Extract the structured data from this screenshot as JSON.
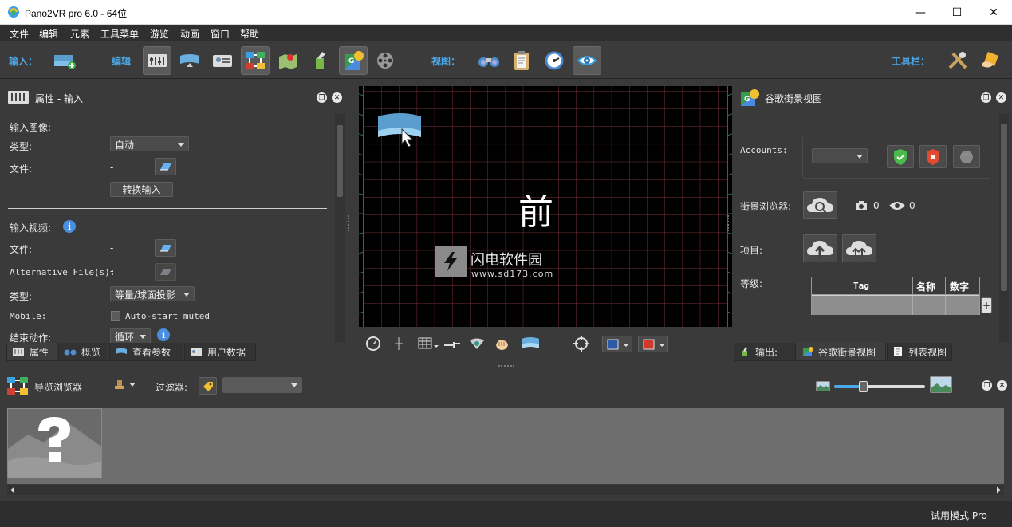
{
  "window": {
    "title": "Pano2VR pro 6.0 - 64位",
    "minimize": "—",
    "maximize": "☐",
    "close": "✕"
  },
  "menu": [
    "文件",
    "编辑",
    "元素",
    "工具菜单",
    "游览",
    "动画",
    "窗口",
    "帮助"
  ],
  "toolbar": {
    "input_label": "输入：",
    "edit_label": "编辑",
    "view_label": "视图：",
    "tools_label": "工具栏："
  },
  "properties": {
    "title": "属性 - 输入",
    "input_image": "输入图像:",
    "type_label": "类型:",
    "type_value": "自动",
    "file_label": "文件:",
    "file_value": "-",
    "convert_button": "转换输入",
    "input_video": "输入视频:",
    "video_file_label": "文件:",
    "video_file_value": "-",
    "alt_file_label": "Alternative File(s):",
    "alt_file_value": "-",
    "video_type_label": "类型:",
    "video_type_value": "等量/球面投影",
    "mobile_label": "Mobile:",
    "autostart_label": "Auto-start muted",
    "end_action_label": "结束动作:",
    "end_action_value": "循环"
  },
  "left_tabs": [
    "属性",
    "概览",
    "查看参数",
    "用户数据"
  ],
  "viewport": {
    "face_label": "前",
    "watermark_cn": "闪电软件园",
    "watermark_url": "www.sd173.com"
  },
  "streetview": {
    "title": "谷歌街景视图",
    "accounts_label": "Accounts:",
    "browser_label": "街景浏览器:",
    "photo_count": "0",
    "view_count": "0",
    "project_label": "项目:",
    "level_label": "等级:",
    "table_headers": [
      "Tag",
      "名称",
      "数字"
    ],
    "add_button": "+"
  },
  "right_tabs": [
    "输出:",
    "谷歌街景视图",
    "列表视图"
  ],
  "tour_browser": {
    "title": "导览浏览器",
    "filter_label": "过滤器:",
    "zoom_level": 0.32
  },
  "statusbar": {
    "mode": "试用模式 Pro"
  },
  "colors": {
    "accent": "#4ba8e8",
    "grid": "#7a2f38",
    "grid_edge": "#2a6b55",
    "bg": "#3a3a3a"
  }
}
